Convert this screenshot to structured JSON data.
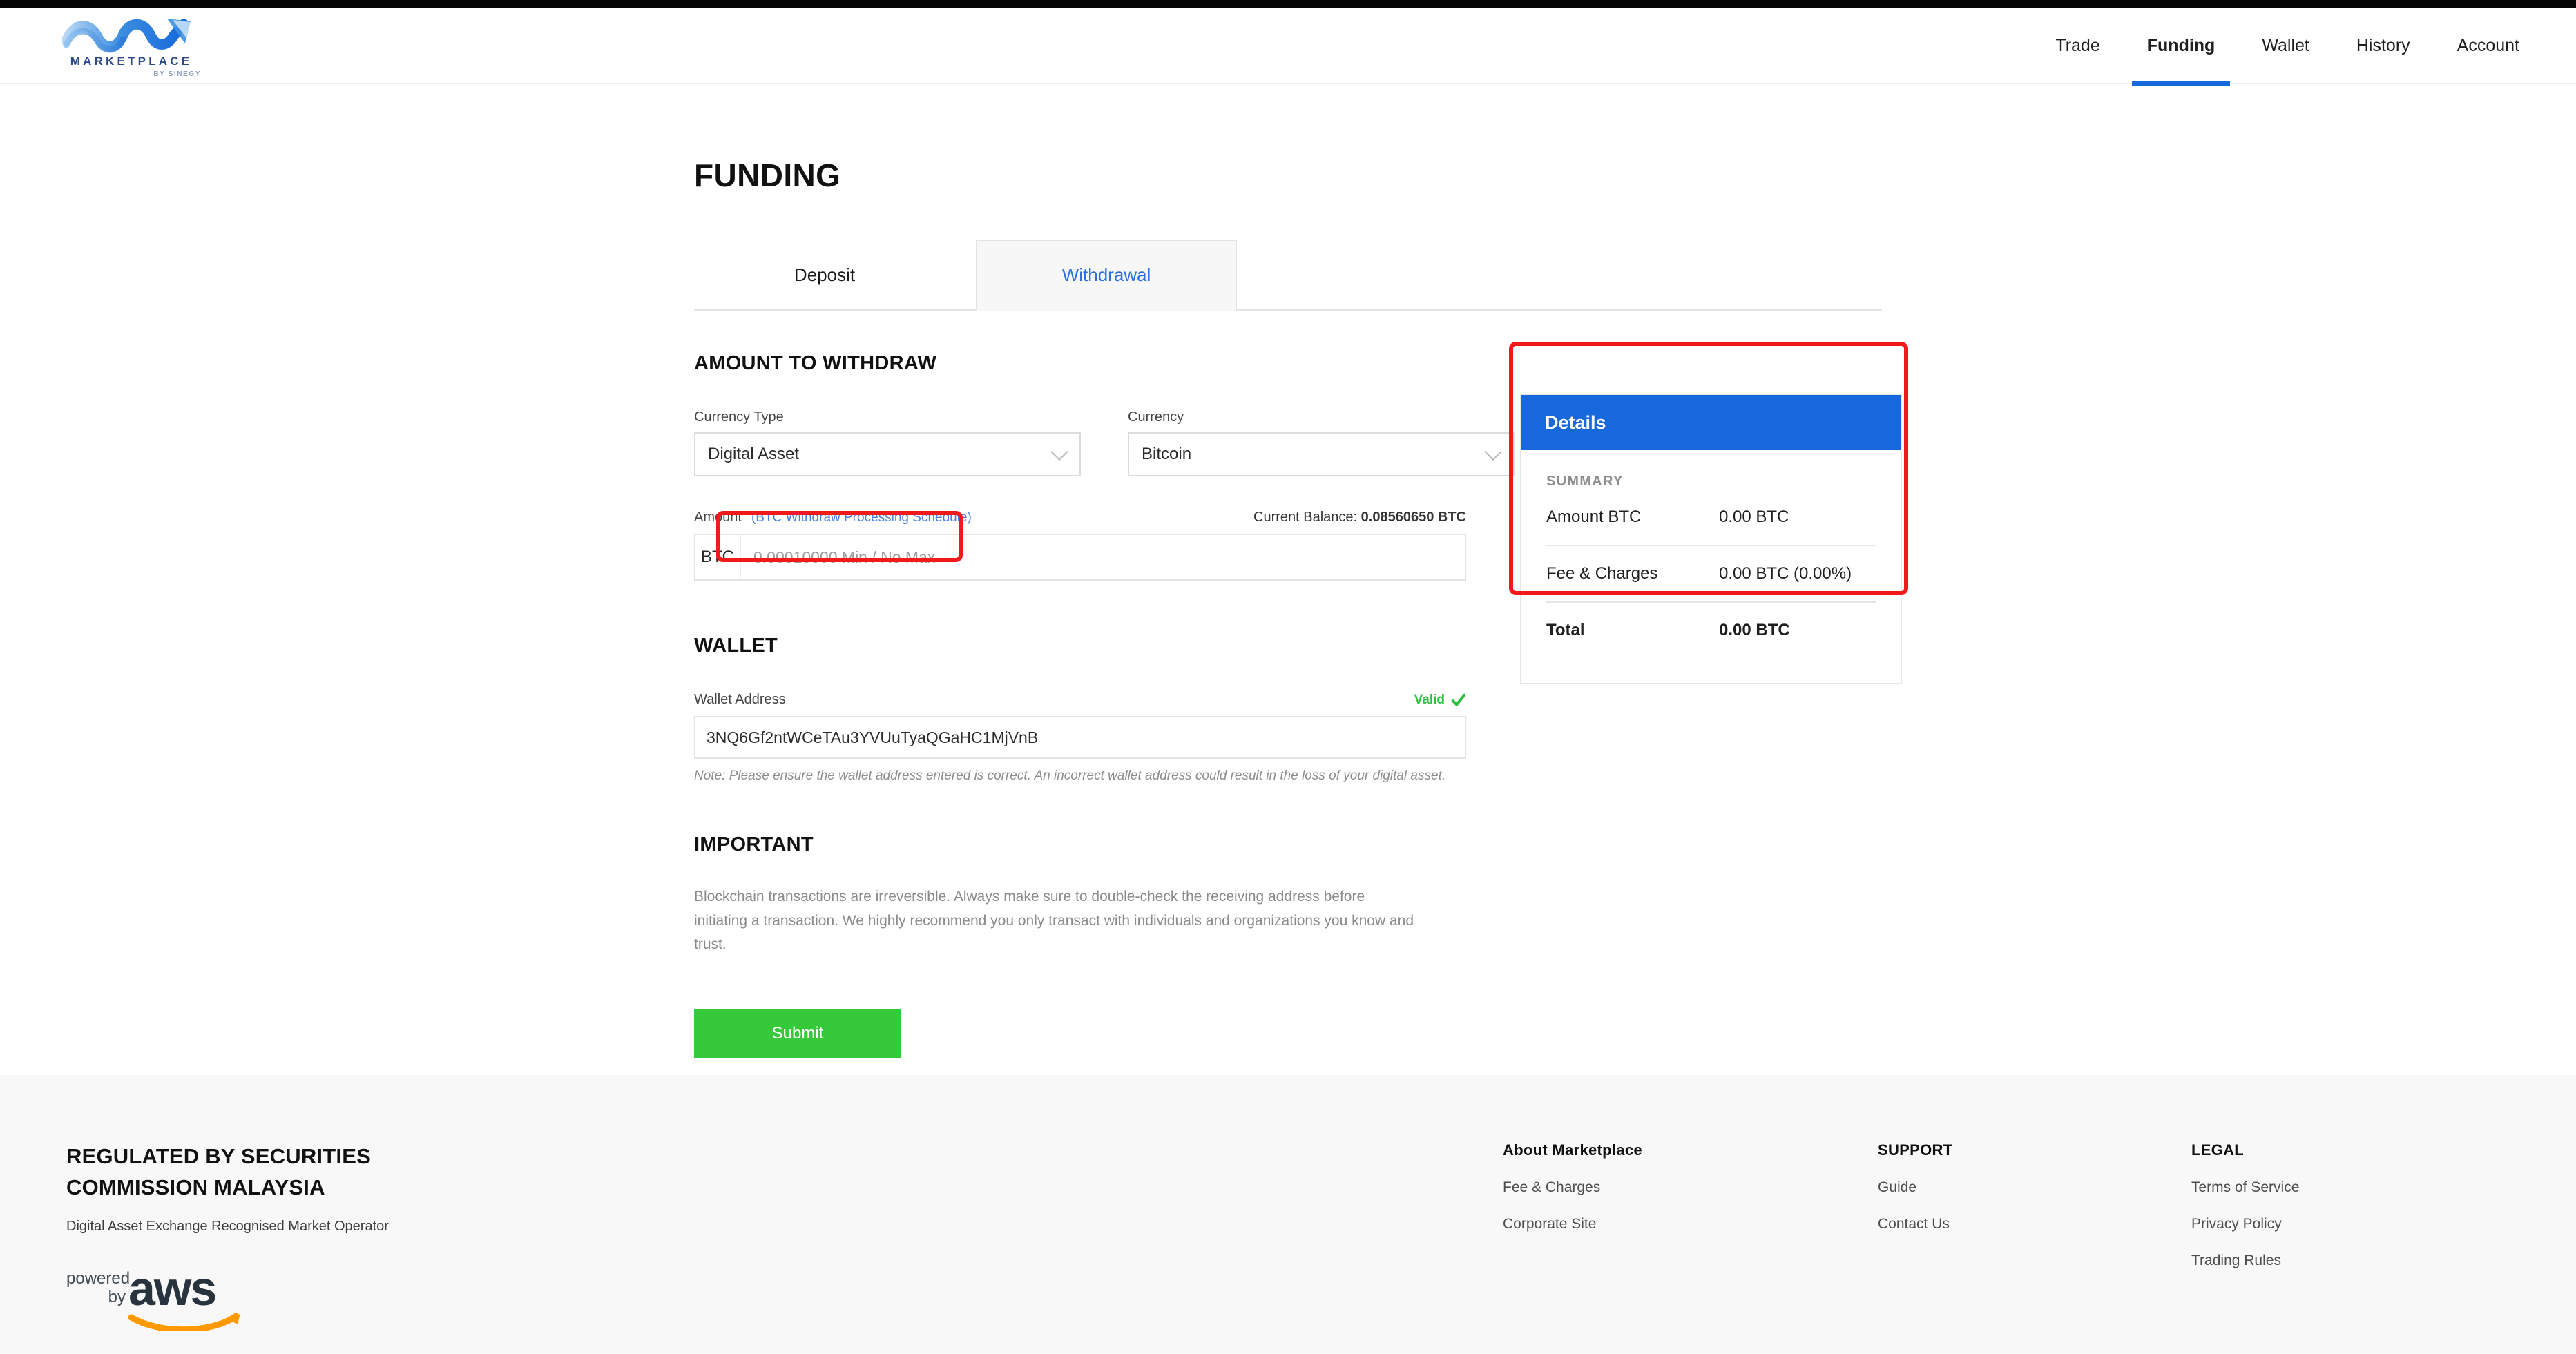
{
  "header": {
    "logo": {
      "name": "MARKETPLACE",
      "tagline": "BY SINEGY"
    },
    "nav": [
      {
        "label": "Trade",
        "active": false
      },
      {
        "label": "Funding",
        "active": true
      },
      {
        "label": "Wallet",
        "active": false
      },
      {
        "label": "History",
        "active": false
      },
      {
        "label": "Account",
        "active": false
      }
    ]
  },
  "main": {
    "page_title": "FUNDING",
    "tabs": [
      {
        "label": "Deposit",
        "active": false
      },
      {
        "label": "Withdrawal",
        "active": true
      }
    ],
    "amount_section": {
      "title": "AMOUNT TO WITHDRAW",
      "currency_type": {
        "label": "Currency Type",
        "value": "Digital Asset"
      },
      "currency": {
        "label": "Currency",
        "value": "Bitcoin"
      },
      "amount": {
        "label": "Amount",
        "schedule_link": "(BTC Withdraw Processing Schedule)",
        "balance_label": "Current Balance:",
        "balance_value": "0.08560650 BTC",
        "prefix": "BTC",
        "value": "",
        "placeholder": "0.00010000 Min / No Max"
      }
    },
    "wallet_section": {
      "title": "WALLET",
      "address_label": "Wallet Address",
      "validity": "Valid",
      "address_value": "3NQ6Gf2ntWCeTAu3YVUuTyaQGaHC1MjVnB",
      "note": "Note: Please ensure the wallet address entered is correct. An incorrect wallet address could result in the loss of your digital asset."
    },
    "important_section": {
      "title": "IMPORTANT",
      "text": "Blockchain transactions are irreversible. Always make sure to double-check the receiving address before initiating a transaction. We highly recommend you only transact with individuals and organizations you know and trust."
    },
    "submit_label": "Submit"
  },
  "details": {
    "header": "Details",
    "summary_label": "SUMMARY",
    "rows": [
      {
        "key": "Amount BTC",
        "value": "0.00 BTC"
      },
      {
        "key": "Fee & Charges",
        "value": "0.00 BTC (0.00%)"
      },
      {
        "key": "Total",
        "value": "0.00 BTC"
      }
    ]
  },
  "footer": {
    "title_line1": "REGULATED BY SECURITIES",
    "title_line2": "COMMISSION MALAYSIA",
    "subtitle": "Digital Asset Exchange Recognised Market Operator",
    "aws": {
      "powered": "powered",
      "by": "by",
      "brand": "aws"
    },
    "columns": [
      {
        "title": "About Marketplace",
        "links": [
          "Fee & Charges",
          "Corporate Site"
        ]
      },
      {
        "title": "SUPPORT",
        "links": [
          "Guide",
          "Contact Us"
        ]
      },
      {
        "title": "LEGAL",
        "links": [
          "Terms of Service",
          "Privacy Policy",
          "Trading Rules"
        ]
      }
    ]
  },
  "colors": {
    "accent_blue": "#1668dc",
    "link_blue": "#4a7fe0",
    "success_green": "#2fbf3e",
    "submit_green": "#36c939",
    "annotation_red": "#f01a1a",
    "footer_bg": "#f8f8f8"
  }
}
